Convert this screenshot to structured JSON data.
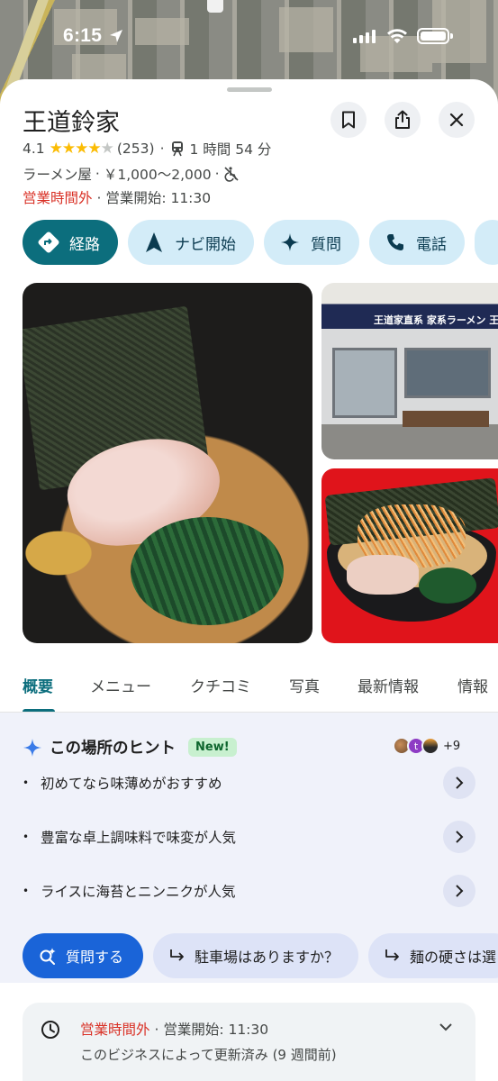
{
  "status_bar": {
    "time": "6:15"
  },
  "place": {
    "name": "王道鈴家",
    "rating": "4.1",
    "stars_filled": 4,
    "review_count": "(253)",
    "transit_time": "1 時間 54 分",
    "category": "ラーメン屋",
    "price": "￥1,000～2,000",
    "status_closed": "営業時間外",
    "opens_at": "営業開始: 11:30"
  },
  "actions": [
    {
      "label": "経路",
      "icon": "directions-icon"
    },
    {
      "label": "ナビ開始",
      "icon": "navigation-icon"
    },
    {
      "label": "質問",
      "icon": "sparkle-icon"
    },
    {
      "label": "電話",
      "icon": "phone-icon"
    }
  ],
  "photos": {
    "shop_sign": "王道家直系 家系ラーメン 王道鈴家"
  },
  "tabs": [
    "概要",
    "メニュー",
    "クチコミ",
    "写真",
    "最新情報",
    "情報"
  ],
  "active_tab": "概要",
  "hints": {
    "title": "この場所のヒント",
    "badge": "New!",
    "avatar_letter": "t",
    "more_count": "+9",
    "items": [
      "初めてなら味薄めがおすすめ",
      "豊富な卓上調味料で味変が人気",
      "ライスに海苔とニンニクが人気"
    ],
    "ask_button": "質問する",
    "suggestions": [
      "駐車場はありますか？",
      "麺の硬さは選"
    ]
  },
  "hours_card": {
    "status_closed": "営業時間外",
    "opens_at": "営業開始: 11:30",
    "updated": "このビジネスによって更新済み (9 週間前)"
  },
  "colors": {
    "accent_teal": "#0c6e7d",
    "chip_bg": "#d3ecf8",
    "closed_red": "#d93025",
    "star_yellow": "#fbbc04",
    "ask_blue": "#1a64d8"
  }
}
